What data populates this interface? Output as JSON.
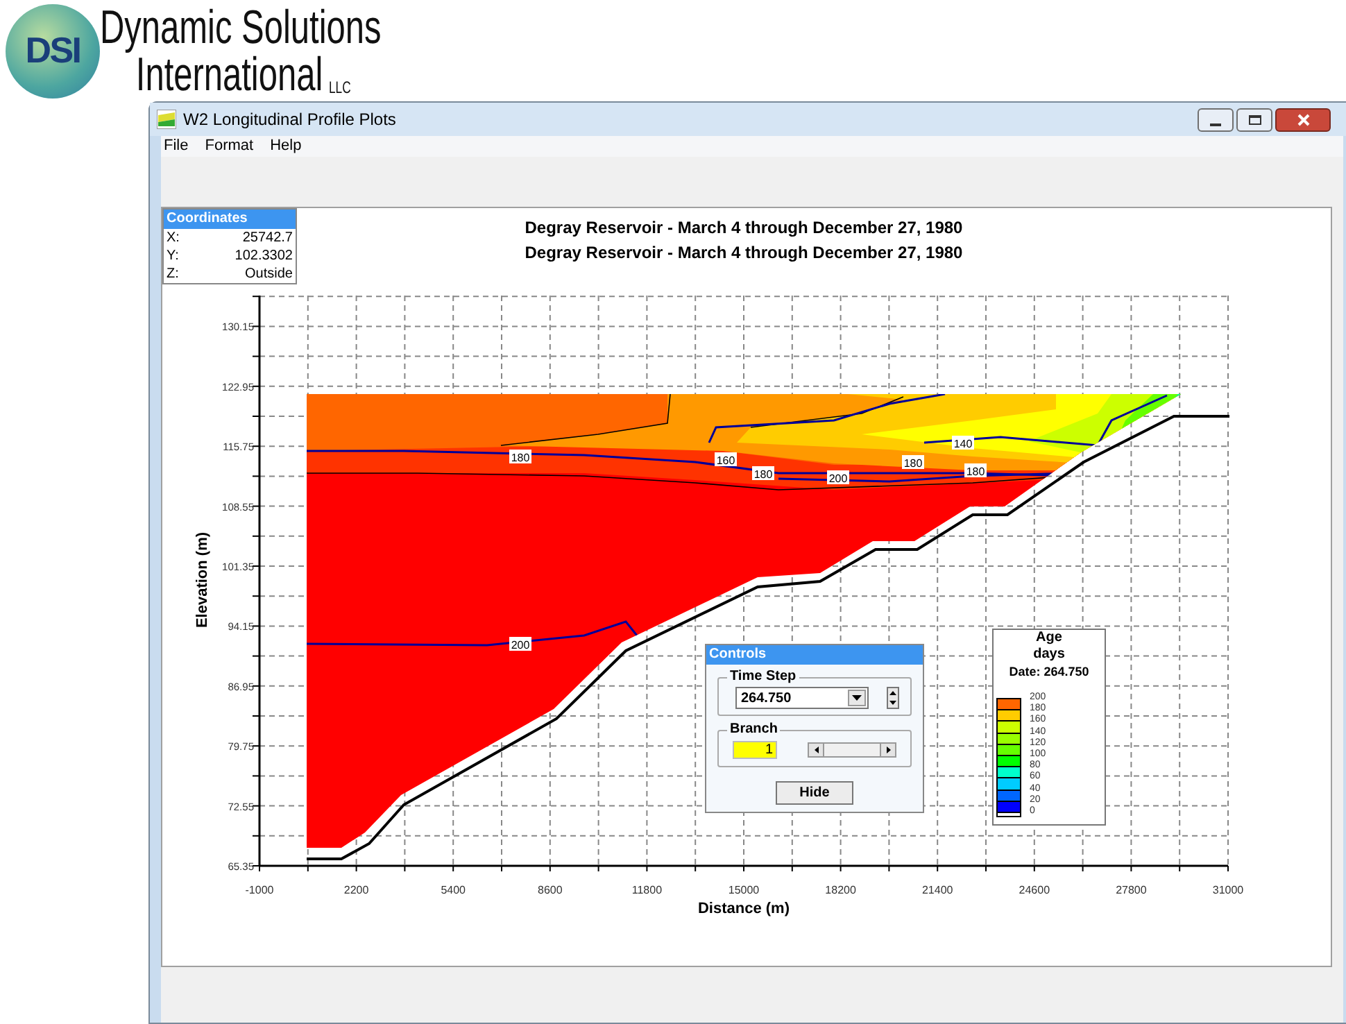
{
  "logo": {
    "mark": "DSI",
    "line1": "Dynamic Solutions",
    "line2": "International",
    "suffix": "LLC"
  },
  "window": {
    "title": "W2 Longitudinal Profile Plots"
  },
  "menu": [
    "File",
    "Format",
    "Help"
  ],
  "coordinates": {
    "title": "Coordinates",
    "rows": [
      {
        "label": "X:",
        "value": "25742.7"
      },
      {
        "label": "Y:",
        "value": "102.3302"
      },
      {
        "label": "Z:",
        "value": "Outside"
      }
    ]
  },
  "plot": {
    "titles": [
      "Degray Reservoir - March 4 through December 27, 1980",
      "Degray Reservoir - March 4 through December 27, 1980"
    ],
    "xlabel": "Distance (m)",
    "ylabel": "Elevation (m)",
    "x_ticks": [
      "-1000",
      "2200",
      "5400",
      "8600",
      "11800",
      "15000",
      "18200",
      "21400",
      "24600",
      "27800",
      "31000"
    ],
    "y_ticks": [
      "130.15",
      "122.95",
      "115.75",
      "108.55",
      "101.35",
      "94.15",
      "86.95",
      "79.75",
      "72.55",
      "65.35"
    ],
    "contour_labels": [
      "180",
      "160",
      "180",
      "200",
      "180",
      "140",
      "180",
      "200"
    ]
  },
  "controls": {
    "title": "Controls",
    "time_step": {
      "label": "Time Step",
      "value": "264.750"
    },
    "branch": {
      "label": "Branch",
      "value": "1"
    },
    "hide_button": "Hide"
  },
  "legend": {
    "title": "Age",
    "unit": "days",
    "date": "Date: 264.750",
    "labels": [
      "200",
      "180",
      "160",
      "140",
      "120",
      "100",
      "80",
      "60",
      "40",
      "20",
      "0"
    ],
    "swatches": [
      {
        "color": "#ff6600"
      },
      {
        "color": "#ffcc00"
      },
      {
        "color": "#ccff00"
      },
      {
        "color": "#99ff00"
      },
      {
        "color": "#66ff00"
      },
      {
        "color": "#00ff00"
      },
      {
        "color": "#00ffcc"
      },
      {
        "color": "#00ccff"
      },
      {
        "color": "#0066ff"
      },
      {
        "color": "#0000ff"
      }
    ]
  }
}
